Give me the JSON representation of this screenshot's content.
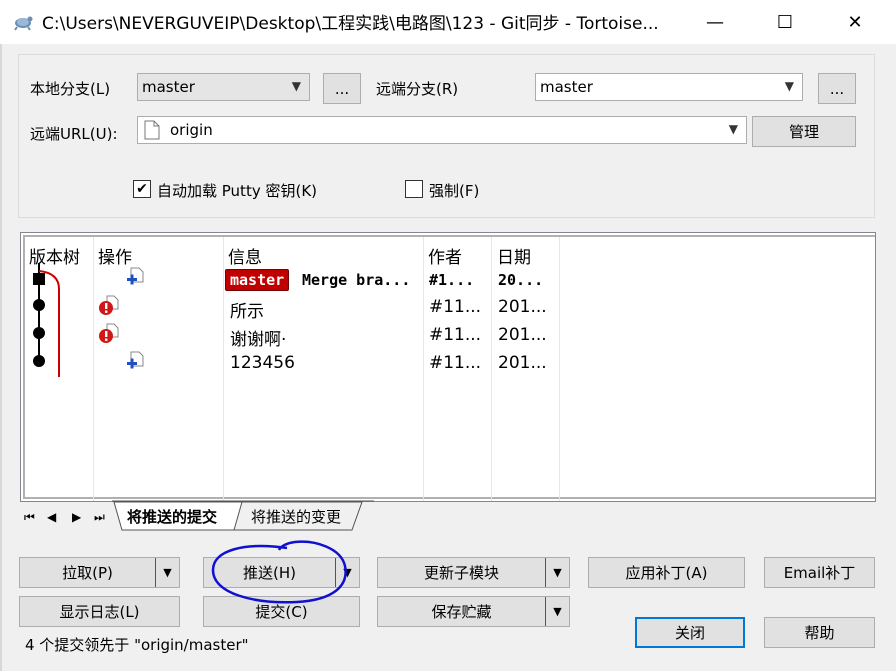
{
  "window": {
    "title": "C:\\Users\\NEVERGUVEIP\\Desktop\\工程实践\\电路图\\123 - Git同步 - Tortoise...",
    "minimize": "—",
    "maximize": "☐",
    "close": "✕"
  },
  "branches": {
    "local_label": "本地分支(L)",
    "local_value": "master",
    "local_more": "...",
    "remote_label": "远端分支(R)",
    "remote_value": "master",
    "remote_more": "...",
    "url_label": "远端URL(U):",
    "url_value": "origin",
    "manage_label": "管理"
  },
  "options": {
    "autoload_putty_label": "自动加载 Putty 密钥(K)",
    "autoload_putty_checked": true,
    "force_label": "强制(F)",
    "force_checked": false
  },
  "log": {
    "columns": [
      "版本树",
      "操作",
      "信息",
      "作者",
      "日期"
    ],
    "rows": [
      {
        "badge": "master",
        "message": "Merge bra...",
        "author": "#1...",
        "date": "20...",
        "action": "add"
      },
      {
        "badge": "",
        "message": "所示",
        "author": "#11...",
        "date": "201...",
        "action": "conflict"
      },
      {
        "badge": "",
        "message": "谢谢啊·",
        "author": "#11...",
        "date": "201...",
        "action": "conflict"
      },
      {
        "badge": "",
        "message": "123456",
        "author": "#11...",
        "date": "201...",
        "action": "add"
      }
    ]
  },
  "tabs": {
    "nav_first": "⏮",
    "nav_prev": "◀",
    "nav_next": "▶",
    "nav_last": "⏭",
    "active": "将推送的提交",
    "inactive": "将推送的变更"
  },
  "buttons": {
    "pull": "拉取(P)",
    "push": "推送(H)",
    "update_submodules": "更新子模块",
    "apply_patch": "应用补丁(A)",
    "email_patch": "Email补丁",
    "show_log": "显示日志(L)",
    "commit": "提交(C)",
    "stash": "保存贮藏",
    "close": "关闭",
    "help": "帮助"
  },
  "status": "4 个提交领先于 \"origin/master\"",
  "colors": {
    "badge": "#c00000",
    "graph_line": "#cc0000",
    "annotation": "#1010d0",
    "default_button_border": "#0078d7"
  }
}
